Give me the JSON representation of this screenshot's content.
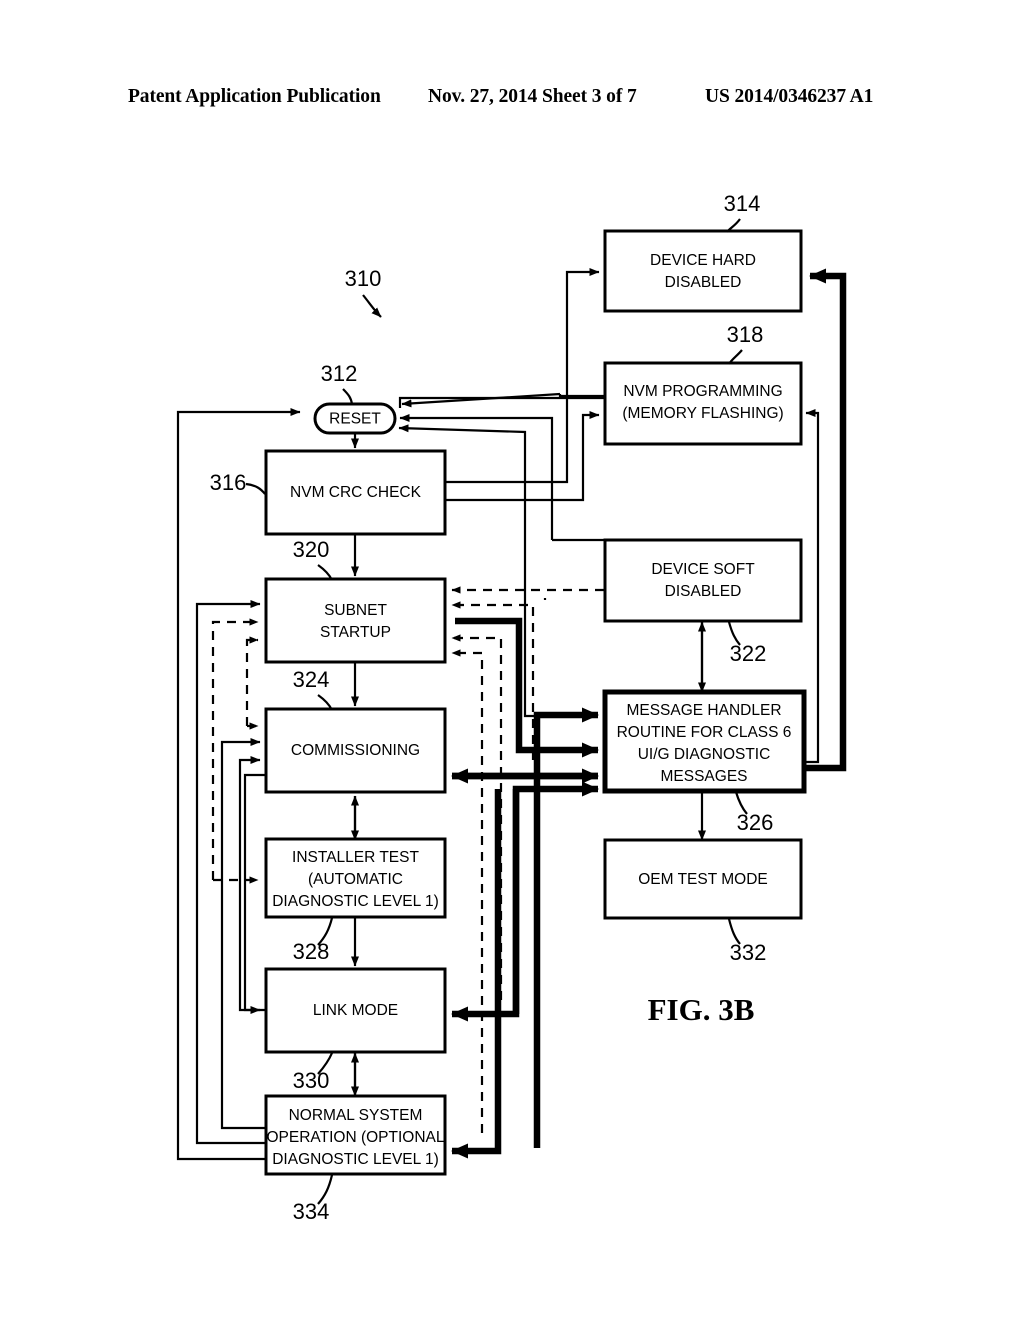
{
  "header": {
    "left": "Patent Application Publication",
    "middle": "Nov. 27, 2014  Sheet 3 of 7",
    "right": "US 2014/0346237 A1"
  },
  "figure": {
    "caption": "FIG. 3B",
    "diagram_ref": "310",
    "nodes": [
      {
        "id": "reset",
        "ref": "312",
        "shape": "stadium",
        "lines": [
          "RESET"
        ]
      },
      {
        "id": "nvm_crc",
        "ref": "316",
        "shape": "rect",
        "lines": [
          "NVM CRC CHECK"
        ]
      },
      {
        "id": "subnet",
        "ref": "320",
        "shape": "rect",
        "lines": [
          "SUBNET",
          "STARTUP"
        ]
      },
      {
        "id": "commissioning",
        "ref": "324",
        "shape": "rect",
        "lines": [
          "COMMISSIONING"
        ]
      },
      {
        "id": "installer",
        "ref": "328",
        "shape": "rect",
        "lines": [
          "INSTALLER TEST",
          "(AUTOMATIC",
          "DIAGNOSTIC LEVEL 1)"
        ]
      },
      {
        "id": "link_mode",
        "ref": "330",
        "shape": "rect",
        "lines": [
          "LINK MODE"
        ]
      },
      {
        "id": "normal_op",
        "ref": "334",
        "shape": "rect",
        "lines": [
          "NORMAL SYSTEM",
          "OPERATION (OPTIONAL",
          "DIAGNOSTIC LEVEL 1)"
        ]
      },
      {
        "id": "hard_disabled",
        "ref": "314",
        "shape": "rect",
        "lines": [
          "DEVICE HARD",
          "DISABLED"
        ]
      },
      {
        "id": "nvm_prog",
        "ref": "318",
        "shape": "rect",
        "lines": [
          "NVM PROGRAMMING",
          "(MEMORY FLASHING)"
        ]
      },
      {
        "id": "soft_disabled",
        "ref": "322",
        "shape": "rect",
        "lines": [
          "DEVICE SOFT",
          "DISABLED"
        ]
      },
      {
        "id": "msg_handler",
        "ref": "326",
        "shape": "rect-bold",
        "lines": [
          "MESSAGE HANDLER",
          "ROUTINE FOR CLASS 6",
          "UI/G DIAGNOSTIC",
          "MESSAGES"
        ]
      },
      {
        "id": "oem_test",
        "ref": "332",
        "shape": "rect",
        "lines": [
          "OEM TEST MODE"
        ]
      }
    ],
    "node_text": {
      "reset_l1": "RESET",
      "nvm_crc_l1": "NVM CRC CHECK",
      "subnet_l1": "SUBNET",
      "subnet_l2": "STARTUP",
      "commissioning_l1": "COMMISSIONING",
      "installer_l1": "INSTALLER TEST",
      "installer_l2": "(AUTOMATIC",
      "installer_l3": "DIAGNOSTIC LEVEL 1)",
      "link_mode_l1": "LINK MODE",
      "normal_op_l1": "NORMAL SYSTEM",
      "normal_op_l2": "OPERATION (OPTIONAL",
      "normal_op_l3": "DIAGNOSTIC LEVEL 1)",
      "hard_disabled_l1": "DEVICE HARD",
      "hard_disabled_l2": "DISABLED",
      "nvm_prog_l1": "NVM PROGRAMMING",
      "nvm_prog_l2": "(MEMORY FLASHING)",
      "soft_disabled_l1": "DEVICE SOFT",
      "soft_disabled_l2": "DISABLED",
      "msg_handler_l1": "MESSAGE HANDLER",
      "msg_handler_l2": "ROUTINE FOR CLASS 6",
      "msg_handler_l3": "UI/G DIAGNOSTIC",
      "msg_handler_l4": "MESSAGES",
      "oem_test_l1": "OEM TEST MODE"
    },
    "ref_numbers": {
      "r310": "310",
      "r312": "312",
      "r314": "314",
      "r316": "316",
      "r318": "318",
      "r320": "320",
      "r322": "322",
      "r324": "324",
      "r326": "326",
      "r328": "328",
      "r330": "330",
      "r332": "332",
      "r334": "334"
    }
  }
}
